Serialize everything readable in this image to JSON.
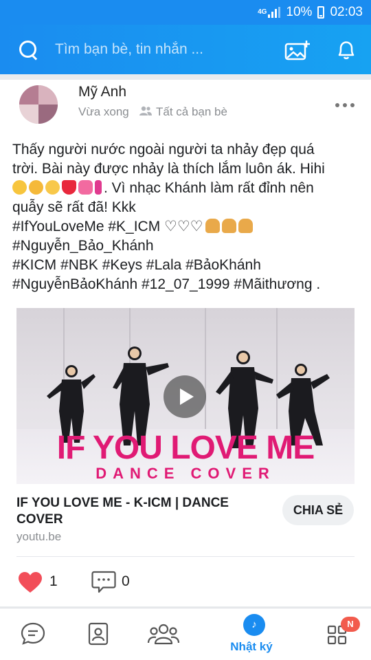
{
  "status_bar": {
    "network": "4G",
    "battery": "10%",
    "time": "02:03"
  },
  "header": {
    "search_placeholder": "Tìm bạn bè, tin nhắn ...",
    "icons": [
      "search-icon",
      "add-photo-icon",
      "bell-icon"
    ]
  },
  "post": {
    "author": "Mỹ Anh",
    "time": "Vừa xong",
    "audience": "Tất cả bạn bè",
    "text": {
      "line1": "Thấy người nước ngoài người ta nhảy đẹp quá",
      "line2": "trời. Bài này được nhảy là thích lắm luôn ák. Hihi",
      "line3": ". Vì nhạc Khánh làm rất đỉnh nên",
      "line4": "quẫy sẽ rất đã! Kkk",
      "line5": "#IfYouLoveMe #K_ICM ♡♡♡",
      "line6": "#Nguyễn_Bảo_Khánh",
      "line7": "#KICM #NBK #Keys #Lala #BảoKhánh",
      "line8": "#NguyễnBảoKhánh #12_07_1999 #Mãithương ."
    },
    "video": {
      "art_title": "IF YOU LOVE ME",
      "art_subtitle": "DANCE COVER"
    },
    "link": {
      "title": "IF YOU LOVE ME - K-ICM | DANCE COVER",
      "domain": "youtu.be",
      "share_label": "CHIA SẺ"
    },
    "likes": "1",
    "comments": "0"
  },
  "bottom_nav": {
    "items": [
      "messages",
      "contacts",
      "groups",
      "Nhật ký",
      "more"
    ],
    "active_label": "Nhật ký",
    "badge": "N"
  },
  "colors": {
    "brand": "#1a8cf0",
    "heart": "#f24e59",
    "title_art": "#e01a74"
  }
}
